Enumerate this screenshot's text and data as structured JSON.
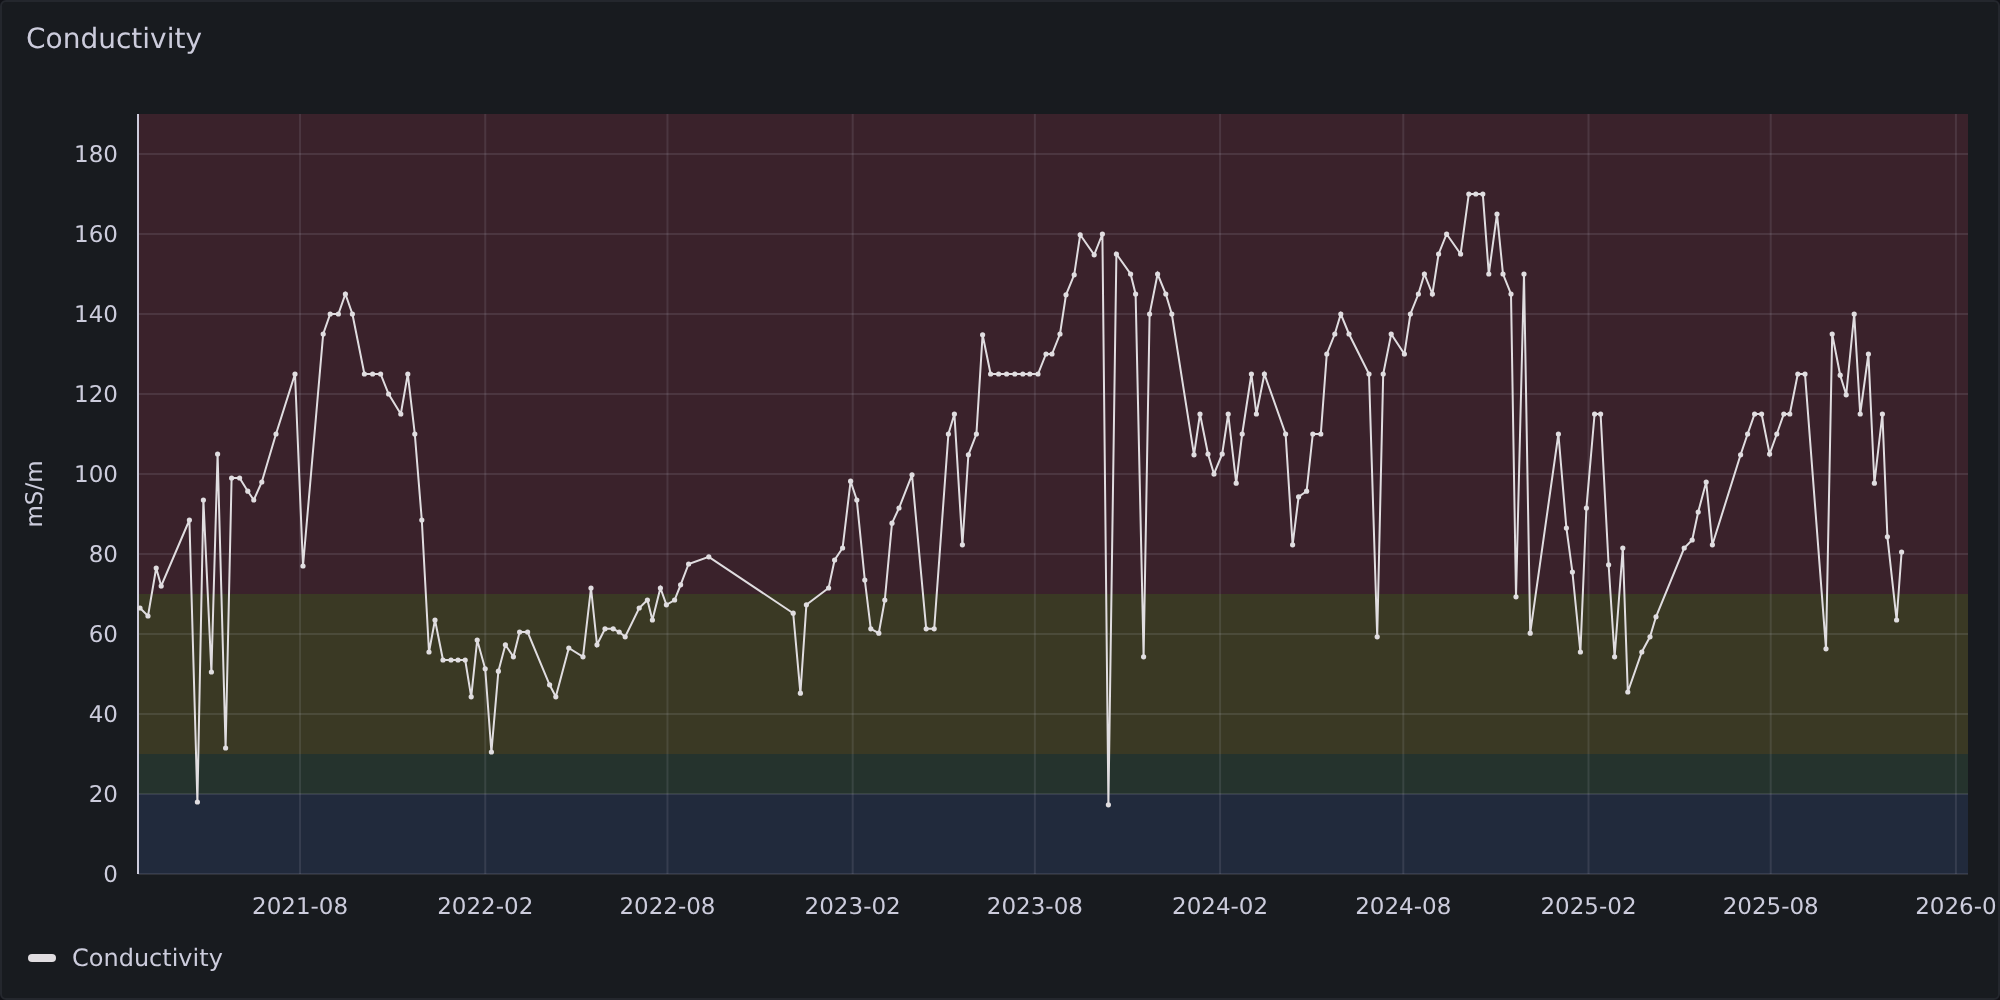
{
  "panel": {
    "title": "Conductivity",
    "chart_data": {
      "type": "line",
      "ylabel": "mS/m",
      "xlim": [
        "2021-02-21",
        "2026-02-13"
      ],
      "ylim": [
        0,
        190
      ],
      "yticks": [
        0,
        20,
        40,
        60,
        80,
        100,
        120,
        140,
        160,
        180
      ],
      "xticks": [
        {
          "value": "2021-08-01",
          "label": "2021-08"
        },
        {
          "value": "2022-02-01",
          "label": "2022-02"
        },
        {
          "value": "2022-08-01",
          "label": "2022-08"
        },
        {
          "value": "2023-02-01",
          "label": "2023-02"
        },
        {
          "value": "2023-08-01",
          "label": "2023-08"
        },
        {
          "value": "2024-02-01",
          "label": "2024-02"
        },
        {
          "value": "2024-08-01",
          "label": "2024-08"
        },
        {
          "value": "2025-02-01",
          "label": "2025-02"
        },
        {
          "value": "2025-08-01",
          "label": "2025-08"
        },
        {
          "value": "2026-02-01",
          "label": "2026-0"
        }
      ],
      "x": [
        "2021-02-23",
        "2021-03-03",
        "2021-03-11",
        "2021-03-16",
        "2021-04-13",
        "2021-04-21",
        "2021-04-27",
        "2021-05-05",
        "2021-05-11",
        "2021-05-19",
        "2021-05-25",
        "2021-06-02",
        "2021-06-10",
        "2021-06-16",
        "2021-06-24",
        "2021-07-08",
        "2021-07-27",
        "2021-08-04",
        "2021-08-24",
        "2021-08-31",
        "2021-09-08",
        "2021-09-15",
        "2021-09-22",
        "2021-10-04",
        "2021-10-12",
        "2021-10-20",
        "2021-10-28",
        "2021-11-09",
        "2021-11-16",
        "2021-11-23",
        "2021-11-30",
        "2021-12-07",
        "2021-12-13",
        "2021-12-21",
        "2021-12-29",
        "2022-01-05",
        "2022-01-12",
        "2022-01-18",
        "2022-01-24",
        "2022-02-01",
        "2022-02-07",
        "2022-02-14",
        "2022-02-21",
        "2022-03-01",
        "2022-03-07",
        "2022-03-15",
        "2022-04-06",
        "2022-04-12",
        "2022-04-25",
        "2022-05-09",
        "2022-05-17",
        "2022-05-23",
        "2022-05-31",
        "2022-06-08",
        "2022-06-14",
        "2022-06-20",
        "2022-07-04",
        "2022-07-12",
        "2022-07-17",
        "2022-07-25",
        "2022-07-31",
        "2022-08-08",
        "2022-08-14",
        "2022-08-22",
        "2022-09-11",
        "2022-12-04",
        "2022-12-11",
        "2022-12-17",
        "2023-01-08",
        "2023-01-14",
        "2023-01-22",
        "2023-01-30",
        "2023-02-05",
        "2023-02-13",
        "2023-02-19",
        "2023-02-27",
        "2023-03-05",
        "2023-03-12",
        "2023-03-19",
        "2023-04-01",
        "2023-04-15",
        "2023-04-23",
        "2023-05-07",
        "2023-05-13",
        "2023-05-21",
        "2023-05-27",
        "2023-06-04",
        "2023-06-10",
        "2023-06-18",
        "2023-06-26",
        "2023-07-04",
        "2023-07-12",
        "2023-07-20",
        "2023-07-27",
        "2023-08-04",
        "2023-08-12",
        "2023-08-18",
        "2023-08-26",
        "2023-09-01",
        "2023-09-09",
        "2023-09-15",
        "2023-09-29",
        "2023-10-07",
        "2023-10-13",
        "2023-10-21",
        "2023-11-04",
        "2023-11-09",
        "2023-11-17",
        "2023-11-23",
        "2023-12-01",
        "2023-12-09",
        "2023-12-15",
        "2024-01-06",
        "2024-01-12",
        "2024-01-20",
        "2024-01-26",
        "2024-02-03",
        "2024-02-09",
        "2024-02-17",
        "2024-02-23",
        "2024-03-03",
        "2024-03-08",
        "2024-03-16",
        "2024-04-06",
        "2024-04-13",
        "2024-04-19",
        "2024-04-27",
        "2024-05-03",
        "2024-05-11",
        "2024-05-17",
        "2024-05-25",
        "2024-05-31",
        "2024-06-08",
        "2024-06-28",
        "2024-07-06",
        "2024-07-12",
        "2024-07-20",
        "2024-08-02",
        "2024-08-08",
        "2024-08-16",
        "2024-08-22",
        "2024-08-30",
        "2024-09-05",
        "2024-09-13",
        "2024-09-27",
        "2024-10-05",
        "2024-10-12",
        "2024-10-19",
        "2024-10-25",
        "2024-11-02",
        "2024-11-08",
        "2024-11-16",
        "2024-11-21",
        "2024-11-29",
        "2024-12-05",
        "2025-01-02",
        "2025-01-10",
        "2025-01-16",
        "2025-01-24",
        "2025-01-30",
        "2025-02-07",
        "2025-02-13",
        "2025-02-21",
        "2025-02-27",
        "2025-03-07",
        "2025-03-12",
        "2025-03-26",
        "2025-04-03",
        "2025-04-09",
        "2025-05-07",
        "2025-05-15",
        "2025-05-21",
        "2025-05-29",
        "2025-06-04",
        "2025-07-02",
        "2025-07-09",
        "2025-07-16",
        "2025-07-23",
        "2025-07-31",
        "2025-08-07",
        "2025-08-14",
        "2025-08-20",
        "2025-08-28",
        "2025-09-04",
        "2025-09-25",
        "2025-10-01",
        "2025-10-09",
        "2025-10-15",
        "2025-10-23",
        "2025-10-29",
        "2025-11-06",
        "2025-11-12",
        "2025-11-20",
        "2025-11-25",
        "2025-12-04",
        "2025-12-09"
      ],
      "grid": true,
      "bands": [
        {
          "axis": "y",
          "from": 0,
          "to": 20,
          "color": "#212a3c"
        },
        {
          "axis": "y",
          "from": 20,
          "to": 30,
          "color": "#25332d"
        },
        {
          "axis": "y",
          "from": 30,
          "to": 70,
          "color": "#3a3924"
        },
        {
          "axis": "y",
          "from": 70,
          "to": 190,
          "color": "#3a222b"
        }
      ],
      "series": [
        {
          "name": "Conductivity",
          "color": "#e0dde0",
          "values": [
            66.5,
            64.5,
            76.5,
            72,
            88.5,
            18,
            93.5,
            50.5,
            105,
            31.5,
            99,
            99,
            95.7,
            93.5,
            98,
            110,
            125,
            77,
            135,
            140,
            140,
            145,
            140,
            125,
            125,
            125,
            120,
            115,
            125,
            110,
            88.5,
            55.5,
            63.5,
            53.5,
            53.5,
            53.5,
            53.5,
            44.3,
            58.5,
            51.3,
            30.5,
            50.7,
            57.3,
            54.3,
            60.5,
            60.5,
            47.3,
            44.3,
            56.5,
            54.3,
            71.5,
            57.3,
            61.3,
            61.3,
            60.5,
            59.3,
            66.5,
            68.5,
            63.5,
            71.5,
            67.3,
            68.5,
            72.3,
            77.5,
            79.3,
            65.2,
            45.2,
            67.3,
            71.5,
            78.5,
            81.5,
            98.2,
            93.5,
            73.5,
            61.3,
            60.2,
            68.5,
            87.7,
            91.5,
            99.8,
            61.3,
            61.3,
            110,
            115,
            82.3,
            104.8,
            110,
            134.8,
            125,
            125,
            125,
            125,
            125,
            125,
            125,
            130,
            130,
            135,
            144.8,
            149.8,
            159.8,
            154.8,
            160,
            17.3,
            155,
            150,
            145,
            54.3,
            140,
            150,
            145,
            140,
            104.8,
            115,
            105,
            100,
            105,
            115,
            97.7,
            110,
            125,
            115,
            125,
            110,
            82.3,
            94.3,
            95.7,
            110,
            110,
            130,
            135,
            140,
            135,
            125,
            59.3,
            125,
            135,
            130,
            140,
            145,
            150,
            145,
            155,
            160,
            155,
            170,
            170,
            170,
            150,
            165,
            150,
            145,
            69.3,
            150,
            60.2,
            110,
            86.5,
            75.5,
            55.5,
            91.5,
            115,
            115,
            77.3,
            54.3,
            81.5,
            45.5,
            55.5,
            59.3,
            64.3,
            81.5,
            83.5,
            90.5,
            98,
            82.3,
            104.8,
            110,
            115,
            115,
            105,
            110,
            115,
            115,
            125,
            125,
            56.3,
            135,
            124.7,
            119.8,
            140,
            115,
            130,
            97.7,
            115,
            84.3,
            63.5,
            80.5
          ]
        }
      ]
    }
  }
}
